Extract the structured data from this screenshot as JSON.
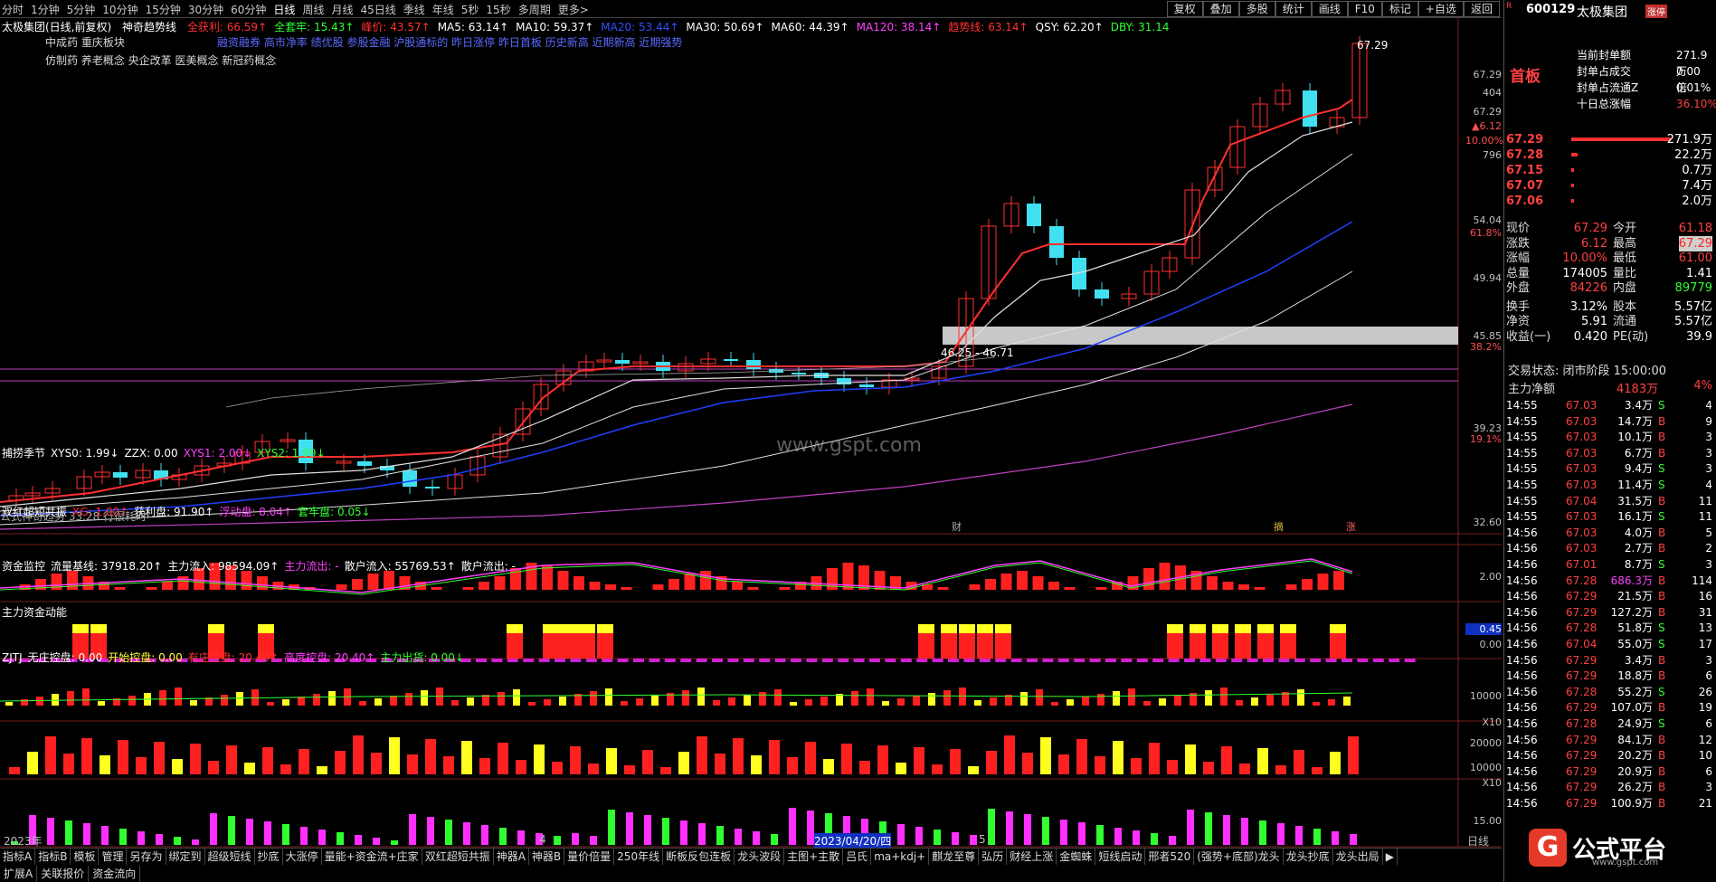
{
  "period_tabs": [
    "分时",
    "1分钟",
    "5分钟",
    "10分钟",
    "15分钟",
    "30分钟",
    "60分钟",
    "日线",
    "周线",
    "月线",
    "45日线",
    "季线",
    "年线",
    "5秒",
    "15秒",
    "多周期",
    "更多>"
  ],
  "active_period": "日线",
  "toolbar": [
    "复权",
    "叠加",
    "多股",
    "统计",
    "画线",
    "F10",
    "标记",
    "+自选",
    "返回"
  ],
  "chart_title": "太极集团(日线,前复权)",
  "trend_name": "神奇趋势线",
  "indicators": [
    {
      "t": "全获利: 66.59↑",
      "c": "#ff3030"
    },
    {
      "t": "全套牢: 15.43↑",
      "c": "#30ff30"
    },
    {
      "t": "峰价: 43.57↑",
      "c": "#ff3030"
    },
    {
      "t": "MA5: 63.14↑",
      "c": "#ffffff"
    },
    {
      "t": "MA10: 59.37↑",
      "c": "#ffffff"
    },
    {
      "t": "MA20: 53.44↑",
      "c": "#3050ff"
    },
    {
      "t": "MA30: 50.69↑",
      "c": "#ffffff"
    },
    {
      "t": "MA60: 44.39↑",
      "c": "#ffffff"
    },
    {
      "t": "MA120: 38.14↑",
      "c": "#ff40ff"
    },
    {
      "t": "趋势线: 63.14↑",
      "c": "#ff3030"
    },
    {
      "t": "QSY: 62.20↑",
      "c": "#ffffff"
    },
    {
      "t": "DBY: 31.14",
      "c": "#30ff30"
    }
  ],
  "blocks_line1": "中成药          重庆板块",
  "concepts": "融资融券 高市净率 绩优股 参股金融 沪股通标的 昨日涨停 昨日首板 历史新高 近期新高 近期强势",
  "concepts_line2": "仿制药 养老概念 央企改革 医美概念 新冠药概念",
  "main_y_labels": [
    {
      "v": "67.29",
      "y": 83
    },
    {
      "v": "404",
      "y": 103
    },
    {
      "v": "67.29",
      "y": 124
    },
    {
      "v": "▲6.12",
      "y": 140
    },
    {
      "v": "10.00%",
      "y": 156
    },
    {
      "v": "796",
      "y": 172
    },
    {
      "v": "54.04",
      "y": 244
    },
    {
      "v": "61.8%",
      "y": 258
    },
    {
      "v": "49.94",
      "y": 308
    },
    {
      "v": "45.85",
      "y": 372
    },
    {
      "v": "38.2%",
      "y": 384
    },
    {
      "v": "39.23",
      "y": 474
    },
    {
      "v": "19.1%",
      "y": 486
    },
    {
      "v": "32.60",
      "y": 578
    }
  ],
  "peak_label": "67.29",
  "band_label": "46.25 - 46.71",
  "bottom_formula": "公式神奇趋势 33.28 行很耗时",
  "watermark": "www.gspt.com",
  "markers": {
    "cai": "财",
    "shang": "摘",
    "zhang": "涨"
  },
  "panels": [
    {
      "title": [
        {
          "t": "捕捞季节",
          "c": "#ffffff"
        },
        {
          "t": "XYS0: 1.99↓",
          "c": "#ffffff"
        },
        {
          "t": "ZZX: 0.00",
          "c": "#ffffff"
        },
        {
          "t": "XYS1: 2.00↓",
          "c": "#ff40ff"
        },
        {
          "t": "XYS2: 1.99↓",
          "c": "#30ff30"
        }
      ],
      "ylabels": [
        {
          "v": "2.00",
          "y": 638
        }
      ]
    },
    {
      "title": [
        {
          "t": "双红超短共振",
          "c": "#ffffff"
        },
        {
          "t": "XG: 1.00↑",
          "c": "#ff3030"
        },
        {
          "t": "获利盘: 91.90↑",
          "c": "#ffffff"
        },
        {
          "t": "浮动盘: 8.04↑",
          "c": "#ff40ff"
        },
        {
          "t": "套牢盘: 0.05↓",
          "c": "#30ff30"
        }
      ],
      "ylabels": [
        {
          "v": "0.45",
          "y": 696
        },
        {
          "v": "0.00",
          "y": 713
        }
      ]
    },
    {
      "title": [
        {
          "t": "资金监控",
          "c": "#ffffff"
        },
        {
          "t": "流量基线: 37918.20↑",
          "c": "#ffffff"
        },
        {
          "t": "主力流入: 98594.09↑",
          "c": "#ffffff"
        },
        {
          "t": "主力流出: -",
          "c": "#ff40ff"
        },
        {
          "t": "散户流入: 55769.53↑",
          "c": "#ffffff"
        },
        {
          "t": "散户流出: -",
          "c": "#ffffff"
        }
      ],
      "ylabels": [
        {
          "v": "10000",
          "y": 770
        },
        {
          "v": "X10",
          "y": 799
        }
      ]
    },
    {
      "title": [
        {
          "t": "主力资金动能",
          "c": "#ffffff"
        }
      ],
      "ylabels": [
        {
          "v": "20000",
          "y": 822
        },
        {
          "v": "10000",
          "y": 849
        },
        {
          "v": "X10",
          "y": 866
        }
      ]
    },
    {
      "title": [
        {
          "t": "ZJTJ",
          "c": "#ffffff"
        },
        {
          "t": "无庄控盘: 0.00",
          "c": "#ffffff"
        },
        {
          "t": "开始控盘: 0.00",
          "c": "#ffff30"
        },
        {
          "t": "有庄控盘: 20.40↑",
          "c": "#ff3030"
        },
        {
          "t": "高度控盘: 20.40↑",
          "c": "#ff40ff"
        },
        {
          "t": "主力出货: 0.00↓",
          "c": "#30ff30"
        }
      ],
      "ylabels": [
        {
          "v": "15.00",
          "y": 908
        }
      ]
    }
  ],
  "xaxis": [
    {
      "v": "2023年",
      "x": 4
    },
    {
      "v": "4",
      "x": 596
    },
    {
      "v": "2023/04/20/四",
      "x": 900
    },
    {
      "v": "5",
      "x": 1082
    },
    {
      "v": "日线",
      "x": 1622
    }
  ],
  "bottom_tabs": [
    "指标A",
    "指标B",
    "模板",
    "管理",
    "另存为",
    "绑定到",
    "超级短线",
    "抄底",
    "大涨停",
    "量能+资金流+庄家",
    "双红超短共振",
    "神器A",
    "神器B",
    "量价倍量",
    "250年线",
    "断板反包连板",
    "龙头波段",
    "主图+主散",
    "吕氏",
    "ma+kdj+",
    "麒龙至尊",
    "弘历",
    "财经上涨",
    "金蜘蛛",
    "短线启动",
    "邢者520",
    "(强势+底部)龙头",
    "龙头抄底",
    "龙头出局"
  ],
  "bottom_tabs2": [
    "扩展A",
    "关联报价",
    "资金流向"
  ],
  "stock": {
    "code": "600129",
    "name": "太极集团",
    "tag": "涨停",
    "seal_label": "首板"
  },
  "seal": [
    {
      "k": "当前封单额",
      "v": "271.9万"
    },
    {
      "k": "封单占成交",
      "v": "0.00倍"
    },
    {
      "k": "封单占流通Z",
      "v": "0.01%"
    },
    {
      "k": "十日总涨幅",
      "v": "36.10%"
    }
  ],
  "book": [
    {
      "p": "67.29",
      "v": "271.9万",
      "bar": 1.0,
      "pc": "#ff4040"
    },
    {
      "p": "67.28",
      "v": "22.2万",
      "bar": 0.06,
      "pc": "#ff4040"
    },
    {
      "p": "67.15",
      "v": "0.7万",
      "bar": 0.02,
      "pc": "#ff4040"
    },
    {
      "p": "67.07",
      "v": "7.4万",
      "bar": 0.03,
      "pc": "#ff4040"
    },
    {
      "p": "67.06",
      "v": "2.0万",
      "bar": 0.02,
      "pc": "#ff4040"
    }
  ],
  "quote": [
    {
      "a": "现价",
      "av": "67.29",
      "b": "今开",
      "bv": "61.18"
    },
    {
      "a": "涨跌",
      "av": "6.12",
      "b": "最高",
      "bv": "67.29"
    },
    {
      "a": "涨幅",
      "av": "10.00%",
      "b": "最低",
      "bv": "61.00"
    },
    {
      "a": "总量",
      "av": "174005",
      "b": "量比",
      "bv": "1.41"
    },
    {
      "a": "外盘",
      "av": "84226",
      "b": "内盘",
      "bv": "89779"
    },
    {
      "a": "换手",
      "av": "3.12%",
      "b": "股本",
      "bv": "5.57亿"
    },
    {
      "a": "净资",
      "av": "5.91",
      "b": "流通",
      "bv": "5.57亿"
    },
    {
      "a": "收益(一)",
      "av": "0.420",
      "b": "PE(动)",
      "bv": "39.9"
    }
  ],
  "status": "交易状态: 闭市阶段  15:00:00",
  "main_flow": {
    "label": "主力净额",
    "value": "4183万",
    "pct": "4%"
  },
  "trades": [
    [
      "14:55",
      "67.03",
      "3.4万",
      "S",
      "4"
    ],
    [
      "14:55",
      "67.03",
      "14.7万",
      "B",
      "9"
    ],
    [
      "14:55",
      "67.03",
      "10.1万",
      "B",
      "3"
    ],
    [
      "14:55",
      "67.03",
      "6.7万",
      "B",
      "3"
    ],
    [
      "14:55",
      "67.03",
      "9.4万",
      "S",
      "3"
    ],
    [
      "14:55",
      "67.03",
      "11.4万",
      "S",
      "4"
    ],
    [
      "14:55",
      "67.04",
      "31.5万",
      "B",
      "11"
    ],
    [
      "14:55",
      "67.03",
      "16.1万",
      "S",
      "11"
    ],
    [
      "14:56",
      "67.03",
      "4.0万",
      "B",
      "5"
    ],
    [
      "14:56",
      "67.03",
      "2.7万",
      "B",
      "2"
    ],
    [
      "14:56",
      "67.01",
      "8.7万",
      "S",
      "3"
    ],
    [
      "14:56",
      "67.28",
      "686.3万",
      "B",
      "114"
    ],
    [
      "14:56",
      "67.29",
      "21.5万",
      "B",
      "16"
    ],
    [
      "14:56",
      "67.29",
      "127.2万",
      "B",
      "31"
    ],
    [
      "14:56",
      "67.28",
      "51.8万",
      "S",
      "13"
    ],
    [
      "14:56",
      "67.04",
      "55.0万",
      "S",
      "17"
    ],
    [
      "14:56",
      "67.29",
      "3.4万",
      "B",
      "3"
    ],
    [
      "14:56",
      "67.29",
      "18.8万",
      "B",
      "6"
    ],
    [
      "14:56",
      "67.28",
      "55.2万",
      "S",
      "26"
    ],
    [
      "14:56",
      "67.29",
      "107.0万",
      "B",
      "19"
    ],
    [
      "14:56",
      "67.28",
      "24.9万",
      "S",
      "6"
    ],
    [
      "14:56",
      "67.29",
      "84.1万",
      "B",
      "12"
    ],
    [
      "14:56",
      "67.29",
      "20.2万",
      "B",
      "10"
    ],
    [
      "14:56",
      "67.29",
      "20.9万",
      "B",
      "6"
    ],
    [
      "14:56",
      "67.29",
      "26.2万",
      "B",
      "3"
    ],
    [
      "14:56",
      "67.29",
      "100.9万",
      "B",
      "21"
    ]
  ],
  "logo": {
    "text": "公式平台",
    "url": "www.gspt.com",
    "glyph": "G"
  },
  "chart_data": {
    "type": "candlestick",
    "symbol": "600129",
    "period": "日线",
    "last_close": 67.29,
    "high": 67.29,
    "ylim": [
      32.6,
      67.29
    ],
    "ma": {
      "MA5": 63.14,
      "MA10": 59.37,
      "MA20": 53.44,
      "MA30": 50.69,
      "MA60": 44.39,
      "MA120": 38.14
    }
  }
}
